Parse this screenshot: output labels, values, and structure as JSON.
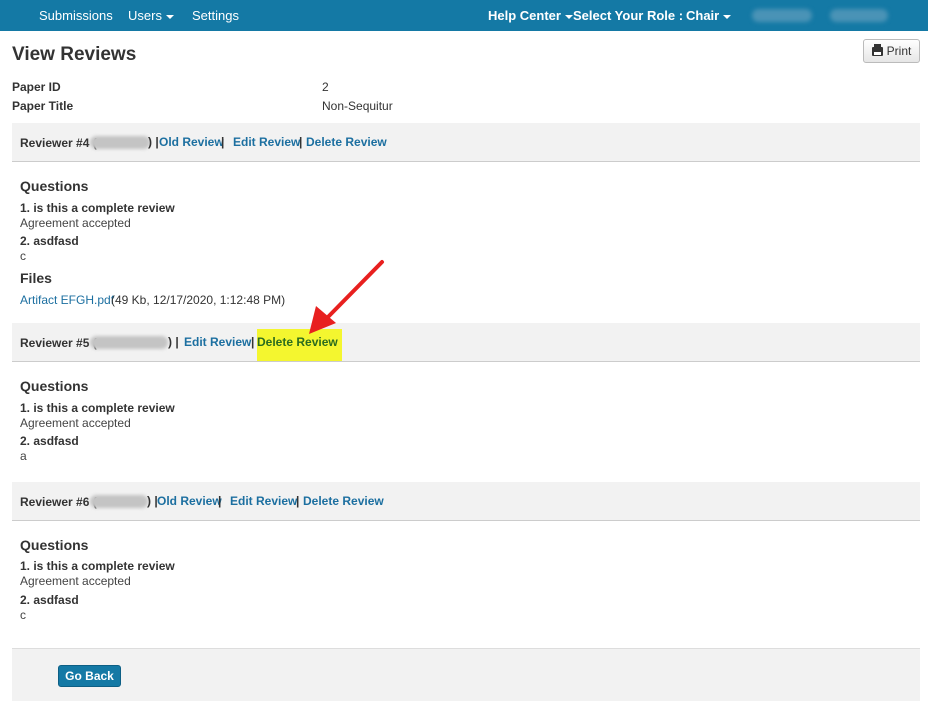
{
  "navbar": {
    "submissions": "Submissions",
    "users": "Users",
    "settings": "Settings",
    "help_center": "Help Center",
    "select_role_label": "Select Your Role :",
    "role": "Chair"
  },
  "header": {
    "title": "View Reviews",
    "print_label": "Print"
  },
  "paper": {
    "id_label": "Paper ID",
    "id_value": "2",
    "title_label": "Paper Title",
    "title_value": "Non-Sequitur"
  },
  "actions": {
    "old_review": "Old Review",
    "edit_review": "Edit Review",
    "delete_review": "Delete Review"
  },
  "reviews": [
    {
      "label": "Reviewer #4 (",
      "questions_heading": "Questions",
      "questions": [
        {
          "q": "1. is this a complete review",
          "a": "Agreement accepted"
        },
        {
          "q": "2. asdfasd",
          "a": "c"
        }
      ],
      "files_heading": "Files",
      "file_name": "Artifact EFGH.pdf",
      "file_meta": "(49 Kb, 12/17/2020, 1:12:48 PM)"
    },
    {
      "label": "Reviewer #5 (",
      "questions_heading": "Questions",
      "questions": [
        {
          "q": "1. is this a complete review",
          "a": "Agreement accepted"
        },
        {
          "q": "2. asdfasd",
          "a": "a"
        }
      ]
    },
    {
      "label": "Reviewer #6 (",
      "questions_heading": "Questions",
      "questions": [
        {
          "q": "1. is this a complete review",
          "a": "Agreement accepted"
        },
        {
          "q": "2. asdfasd",
          "a": "c"
        }
      ]
    }
  ],
  "footer": {
    "go_back": "Go Back"
  },
  "colors": {
    "navbar": "#1479a5",
    "link": "#1c6fa0",
    "highlight": "#f4f62f",
    "annotation_arrow": "#e8201f"
  },
  "icons": {
    "print": "printer-icon",
    "dropdown": "caret-down-icon"
  }
}
